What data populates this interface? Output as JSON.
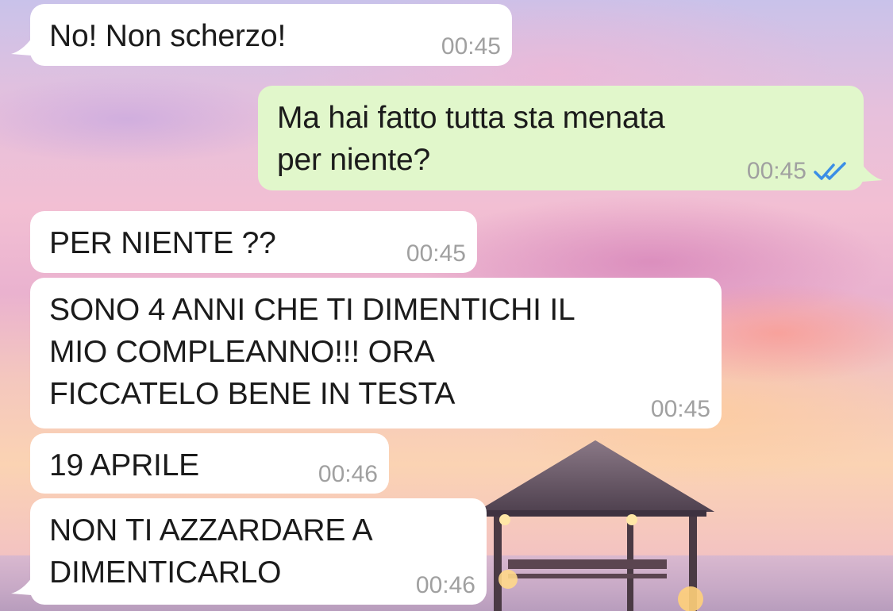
{
  "chat": {
    "messages": [
      {
        "direction": "incoming",
        "text": "No! Non scherzo!",
        "time": "00:45"
      },
      {
        "direction": "outgoing",
        "text": "Ma hai fatto tutta sta menata\nper niente?",
        "time": "00:45",
        "status": "read"
      },
      {
        "direction": "incoming",
        "text": "PER NIENTE ??",
        "time": "00:45"
      },
      {
        "direction": "incoming",
        "text": "SONO 4 ANNI CHE TI DIMENTICHI IL\nMIO COMPLEANNO!!! ORA\nFICCATELO BENE IN TESTA",
        "time": "00:45"
      },
      {
        "direction": "incoming",
        "text": "19 APRILE",
        "time": "00:46"
      },
      {
        "direction": "incoming",
        "text": "NON TI AZZARDARE A\nDIMENTICARLO",
        "time": "00:46"
      }
    ]
  },
  "icons": {
    "read_receipt": "double-check-icon"
  },
  "colors": {
    "incoming_bubble": "#ffffff",
    "outgoing_bubble": "#e1f7cb",
    "timestamp": "#a0a0a0",
    "read_ticks": "#3a8ee6"
  }
}
